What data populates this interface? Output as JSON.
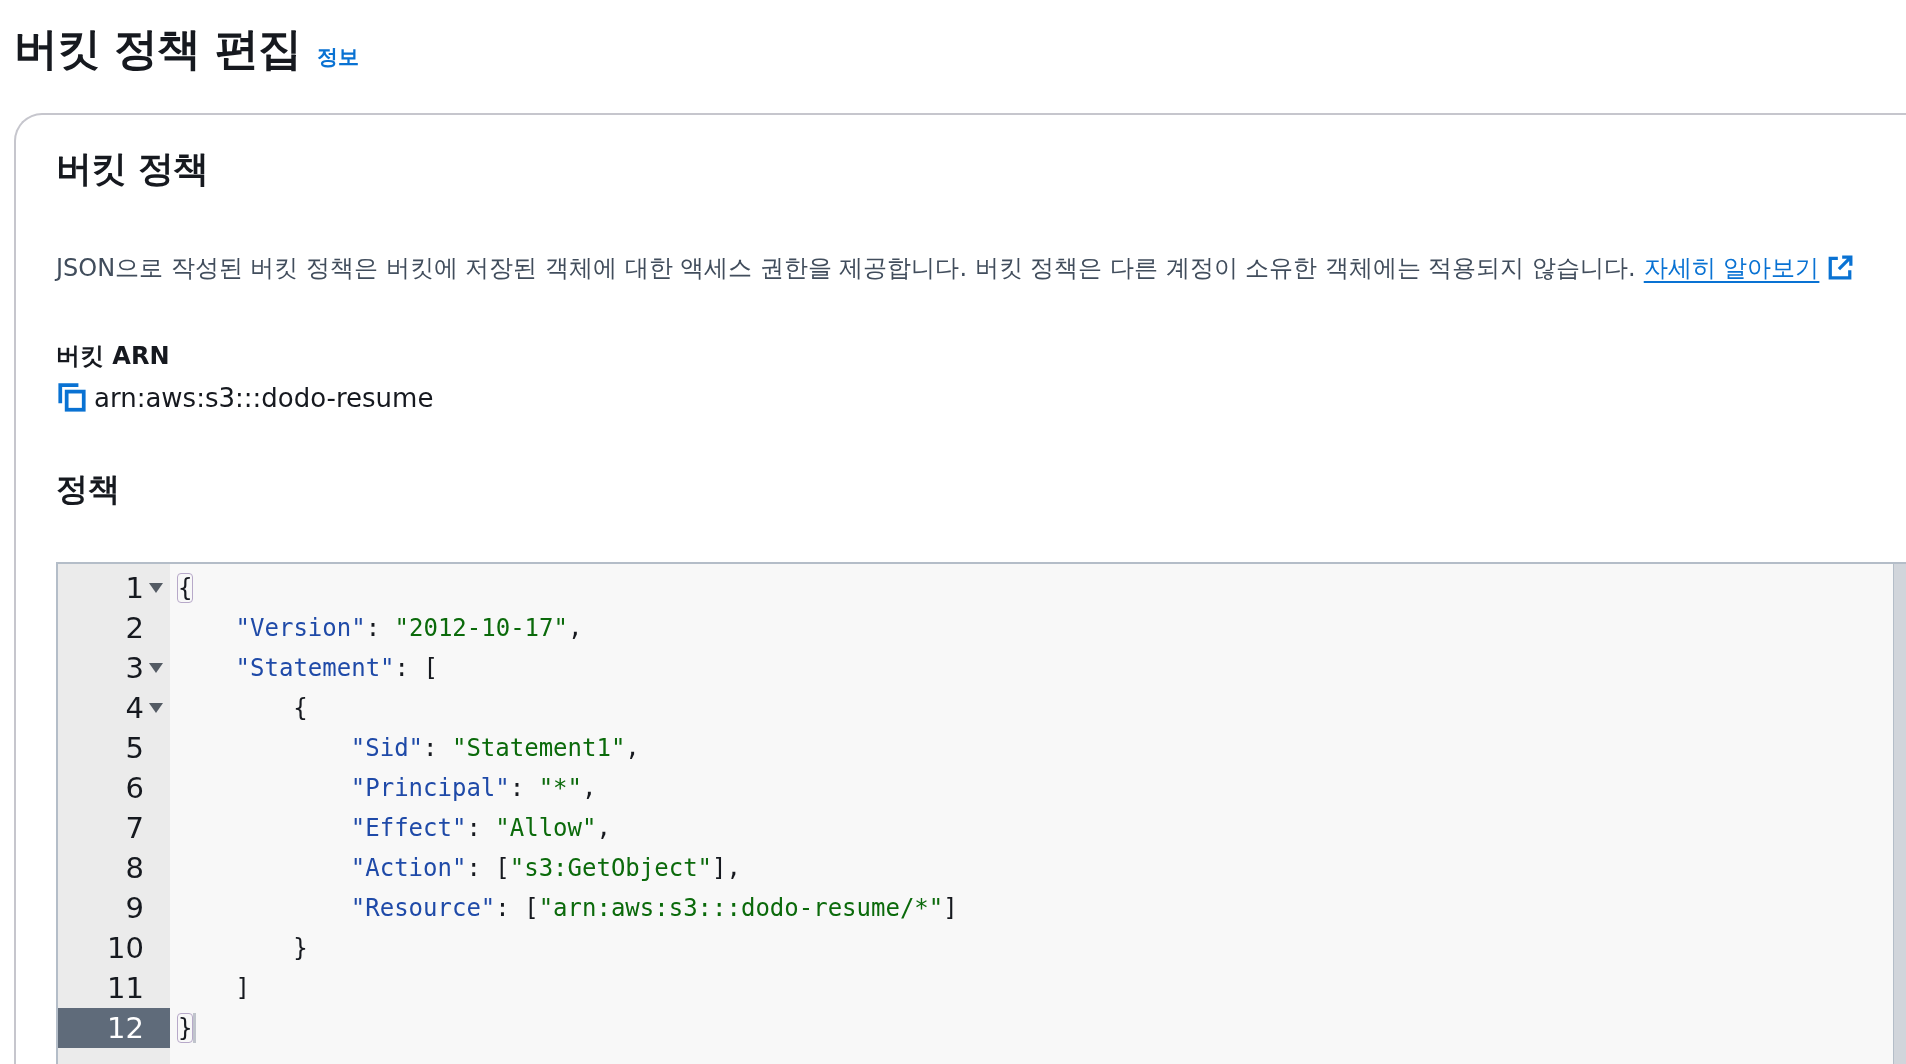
{
  "page_title": "버킷 정책 편집",
  "info_link": "정보",
  "card": {
    "title": "버킷 정책",
    "description": "JSON으로 작성된 버킷 정책은 버킷에 저장된 객체에 대한 액세스 권한을 제공합니다. 버킷 정책은 다른 계정이 소유한 객체에는 적용되지 않습니다.",
    "learn_more": "자세히 알아보기",
    "arn_label": "버킷 ARN",
    "arn_value": "arn:aws:s3:::dodo-resume",
    "policy_label": "정책",
    "editor": {
      "lines": [
        {
          "number": "1",
          "selected": false,
          "tokens": [
            {
              "kind": "punct",
              "text": "{",
              "matched": true
            }
          ],
          "children": [
            {
              "number": "2",
              "selected": false,
              "tokens": [
                {
                  "kind": "key",
                  "text": "\"Version\""
                },
                {
                  "kind": "punct",
                  "text": ": "
                },
                {
                  "kind": "string",
                  "text": "\"2012-10-17\""
                },
                {
                  "kind": "punct",
                  "text": ","
                }
              ]
            },
            {
              "number": "3",
              "selected": false,
              "tokens": [
                {
                  "kind": "key",
                  "text": "\"Statement\""
                },
                {
                  "kind": "punct",
                  "text": ": ["
                }
              ],
              "children": [
                {
                  "number": "4",
                  "selected": false,
                  "tokens": [
                    {
                      "kind": "punct",
                      "text": "{"
                    }
                  ],
                  "children": [
                    {
                      "number": "5",
                      "selected": false,
                      "tokens": [
                        {
                          "kind": "key",
                          "text": "\"Sid\""
                        },
                        {
                          "kind": "punct",
                          "text": ": "
                        },
                        {
                          "kind": "string",
                          "text": "\"Statement1\""
                        },
                        {
                          "kind": "punct",
                          "text": ","
                        }
                      ]
                    },
                    {
                      "number": "6",
                      "selected": false,
                      "tokens": [
                        {
                          "kind": "key",
                          "text": "\"Principal\""
                        },
                        {
                          "kind": "punct",
                          "text": ": "
                        },
                        {
                          "kind": "string",
                          "text": "\"*\""
                        },
                        {
                          "kind": "punct",
                          "text": ","
                        }
                      ]
                    },
                    {
                      "number": "7",
                      "selected": false,
                      "tokens": [
                        {
                          "kind": "key",
                          "text": "\"Effect\""
                        },
                        {
                          "kind": "punct",
                          "text": ": "
                        },
                        {
                          "kind": "string",
                          "text": "\"Allow\""
                        },
                        {
                          "kind": "punct",
                          "text": ","
                        }
                      ]
                    },
                    {
                      "number": "8",
                      "selected": false,
                      "tokens": [
                        {
                          "kind": "key",
                          "text": "\"Action\""
                        },
                        {
                          "kind": "punct",
                          "text": ": ["
                        },
                        {
                          "kind": "string",
                          "text": "\"s3:GetObject\""
                        },
                        {
                          "kind": "punct",
                          "text": "],"
                        }
                      ]
                    },
                    {
                      "number": "9",
                      "selected": false,
                      "tokens": [
                        {
                          "kind": "key",
                          "text": "\"Resource\""
                        },
                        {
                          "kind": "punct",
                          "text": ": ["
                        },
                        {
                          "kind": "string",
                          "text": "\"arn:aws:s3:::dodo-resume/*\""
                        },
                        {
                          "kind": "punct",
                          "text": "]"
                        }
                      ]
                    }
                  ]
                },
                {
                  "number": "10",
                  "selected": false,
                  "tokens": [
                    {
                      "kind": "punct",
                      "text": "}"
                    }
                  ]
                }
              ]
            },
            {
              "number": "11",
              "selected": false,
              "tokens": [
                {
                  "kind": "punct",
                  "text": "]"
                }
              ]
            }
          ]
        },
        {
          "number": "12",
          "selected": true,
          "tokens": [
            {
              "kind": "punct",
              "text": "}",
              "matched": true
            }
          ]
        }
      ]
    }
  }
}
